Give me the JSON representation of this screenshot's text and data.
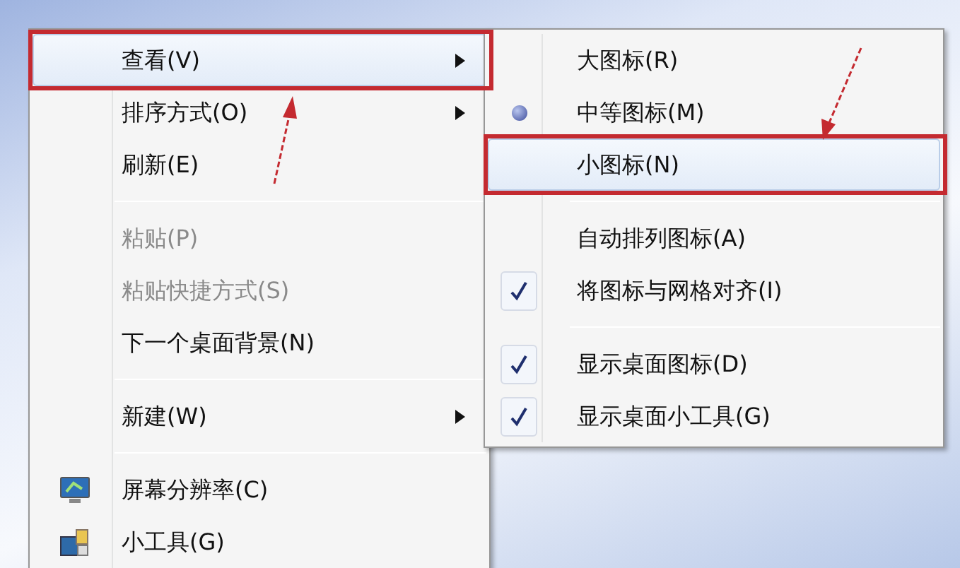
{
  "main_menu": {
    "items": [
      {
        "kind": "plain",
        "label": "查看(V)",
        "disabled": false,
        "has_submenu": true,
        "selected": true,
        "annotated": true
      },
      {
        "kind": "plain",
        "label": "排序方式(O)",
        "disabled": false,
        "has_submenu": true,
        "selected": false,
        "annotated": false
      },
      {
        "kind": "plain",
        "label": "刷新(E)",
        "disabled": false,
        "has_submenu": false,
        "selected": false,
        "annotated": false
      },
      {
        "kind": "separator"
      },
      {
        "kind": "plain",
        "label": "粘贴(P)",
        "disabled": true,
        "has_submenu": false,
        "selected": false,
        "annotated": false
      },
      {
        "kind": "plain",
        "label": "粘贴快捷方式(S)",
        "disabled": true,
        "has_submenu": false,
        "selected": false,
        "annotated": false
      },
      {
        "kind": "plain",
        "label": "下一个桌面背景(N)",
        "disabled": false,
        "has_submenu": false,
        "selected": false,
        "annotated": false
      },
      {
        "kind": "separator"
      },
      {
        "kind": "plain",
        "label": "新建(W)",
        "disabled": false,
        "has_submenu": true,
        "selected": false,
        "annotated": false
      },
      {
        "kind": "separator"
      },
      {
        "kind": "display",
        "label": "屏幕分辨率(C)",
        "disabled": false,
        "has_submenu": false,
        "selected": false,
        "annotated": false
      },
      {
        "kind": "gadget",
        "label": "小工具(G)",
        "disabled": false,
        "has_submenu": false,
        "selected": false,
        "annotated": false
      }
    ]
  },
  "view_submenu": {
    "items": [
      {
        "kind": "radio",
        "label": "大图标(R)",
        "checked": false,
        "selected": false,
        "annotated": false
      },
      {
        "kind": "radio",
        "label": "中等图标(M)",
        "checked": true,
        "selected": false,
        "annotated": false
      },
      {
        "kind": "radio",
        "label": "小图标(N)",
        "checked": false,
        "selected": true,
        "annotated": true
      },
      {
        "kind": "separator"
      },
      {
        "kind": "check",
        "label": "自动排列图标(A)",
        "checked": false,
        "selected": false,
        "annotated": false
      },
      {
        "kind": "check",
        "label": "将图标与网格对齐(I)",
        "checked": true,
        "selected": false,
        "annotated": false
      },
      {
        "kind": "separator"
      },
      {
        "kind": "check",
        "label": "显示桌面图标(D)",
        "checked": true,
        "selected": false,
        "annotated": false
      },
      {
        "kind": "check",
        "label": "显示桌面小工具(G)",
        "checked": true,
        "selected": false,
        "annotated": false
      }
    ]
  }
}
